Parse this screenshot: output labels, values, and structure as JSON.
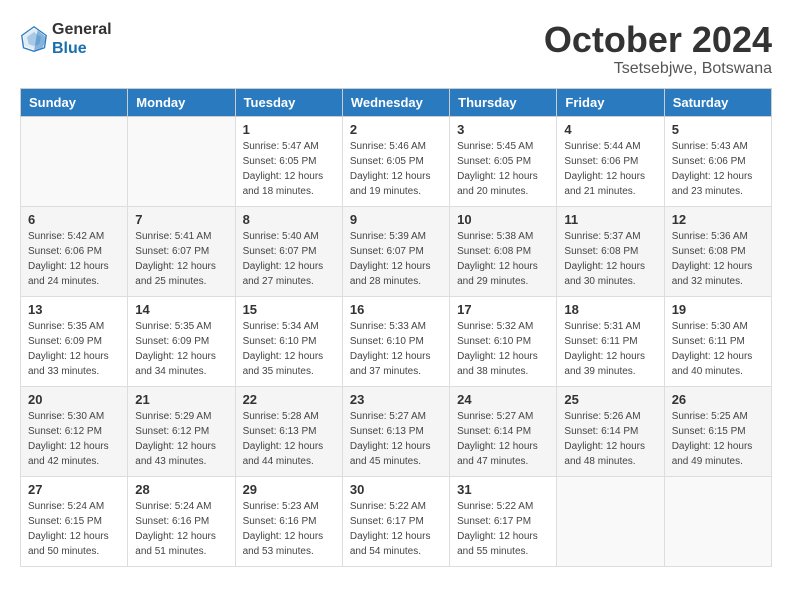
{
  "logo": {
    "general": "General",
    "blue": "Blue"
  },
  "title": "October 2024",
  "location": "Tsetsebjwe, Botswana",
  "days_of_week": [
    "Sunday",
    "Monday",
    "Tuesday",
    "Wednesday",
    "Thursday",
    "Friday",
    "Saturday"
  ],
  "weeks": [
    [
      {
        "day": "",
        "sunrise": "",
        "sunset": "",
        "daylight": ""
      },
      {
        "day": "",
        "sunrise": "",
        "sunset": "",
        "daylight": ""
      },
      {
        "day": "1",
        "sunrise": "Sunrise: 5:47 AM",
        "sunset": "Sunset: 6:05 PM",
        "daylight": "Daylight: 12 hours and 18 minutes."
      },
      {
        "day": "2",
        "sunrise": "Sunrise: 5:46 AM",
        "sunset": "Sunset: 6:05 PM",
        "daylight": "Daylight: 12 hours and 19 minutes."
      },
      {
        "day": "3",
        "sunrise": "Sunrise: 5:45 AM",
        "sunset": "Sunset: 6:05 PM",
        "daylight": "Daylight: 12 hours and 20 minutes."
      },
      {
        "day": "4",
        "sunrise": "Sunrise: 5:44 AM",
        "sunset": "Sunset: 6:06 PM",
        "daylight": "Daylight: 12 hours and 21 minutes."
      },
      {
        "day": "5",
        "sunrise": "Sunrise: 5:43 AM",
        "sunset": "Sunset: 6:06 PM",
        "daylight": "Daylight: 12 hours and 23 minutes."
      }
    ],
    [
      {
        "day": "6",
        "sunrise": "Sunrise: 5:42 AM",
        "sunset": "Sunset: 6:06 PM",
        "daylight": "Daylight: 12 hours and 24 minutes."
      },
      {
        "day": "7",
        "sunrise": "Sunrise: 5:41 AM",
        "sunset": "Sunset: 6:07 PM",
        "daylight": "Daylight: 12 hours and 25 minutes."
      },
      {
        "day": "8",
        "sunrise": "Sunrise: 5:40 AM",
        "sunset": "Sunset: 6:07 PM",
        "daylight": "Daylight: 12 hours and 27 minutes."
      },
      {
        "day": "9",
        "sunrise": "Sunrise: 5:39 AM",
        "sunset": "Sunset: 6:07 PM",
        "daylight": "Daylight: 12 hours and 28 minutes."
      },
      {
        "day": "10",
        "sunrise": "Sunrise: 5:38 AM",
        "sunset": "Sunset: 6:08 PM",
        "daylight": "Daylight: 12 hours and 29 minutes."
      },
      {
        "day": "11",
        "sunrise": "Sunrise: 5:37 AM",
        "sunset": "Sunset: 6:08 PM",
        "daylight": "Daylight: 12 hours and 30 minutes."
      },
      {
        "day": "12",
        "sunrise": "Sunrise: 5:36 AM",
        "sunset": "Sunset: 6:08 PM",
        "daylight": "Daylight: 12 hours and 32 minutes."
      }
    ],
    [
      {
        "day": "13",
        "sunrise": "Sunrise: 5:35 AM",
        "sunset": "Sunset: 6:09 PM",
        "daylight": "Daylight: 12 hours and 33 minutes."
      },
      {
        "day": "14",
        "sunrise": "Sunrise: 5:35 AM",
        "sunset": "Sunset: 6:09 PM",
        "daylight": "Daylight: 12 hours and 34 minutes."
      },
      {
        "day": "15",
        "sunrise": "Sunrise: 5:34 AM",
        "sunset": "Sunset: 6:10 PM",
        "daylight": "Daylight: 12 hours and 35 minutes."
      },
      {
        "day": "16",
        "sunrise": "Sunrise: 5:33 AM",
        "sunset": "Sunset: 6:10 PM",
        "daylight": "Daylight: 12 hours and 37 minutes."
      },
      {
        "day": "17",
        "sunrise": "Sunrise: 5:32 AM",
        "sunset": "Sunset: 6:10 PM",
        "daylight": "Daylight: 12 hours and 38 minutes."
      },
      {
        "day": "18",
        "sunrise": "Sunrise: 5:31 AM",
        "sunset": "Sunset: 6:11 PM",
        "daylight": "Daylight: 12 hours and 39 minutes."
      },
      {
        "day": "19",
        "sunrise": "Sunrise: 5:30 AM",
        "sunset": "Sunset: 6:11 PM",
        "daylight": "Daylight: 12 hours and 40 minutes."
      }
    ],
    [
      {
        "day": "20",
        "sunrise": "Sunrise: 5:30 AM",
        "sunset": "Sunset: 6:12 PM",
        "daylight": "Daylight: 12 hours and 42 minutes."
      },
      {
        "day": "21",
        "sunrise": "Sunrise: 5:29 AM",
        "sunset": "Sunset: 6:12 PM",
        "daylight": "Daylight: 12 hours and 43 minutes."
      },
      {
        "day": "22",
        "sunrise": "Sunrise: 5:28 AM",
        "sunset": "Sunset: 6:13 PM",
        "daylight": "Daylight: 12 hours and 44 minutes."
      },
      {
        "day": "23",
        "sunrise": "Sunrise: 5:27 AM",
        "sunset": "Sunset: 6:13 PM",
        "daylight": "Daylight: 12 hours and 45 minutes."
      },
      {
        "day": "24",
        "sunrise": "Sunrise: 5:27 AM",
        "sunset": "Sunset: 6:14 PM",
        "daylight": "Daylight: 12 hours and 47 minutes."
      },
      {
        "day": "25",
        "sunrise": "Sunrise: 5:26 AM",
        "sunset": "Sunset: 6:14 PM",
        "daylight": "Daylight: 12 hours and 48 minutes."
      },
      {
        "day": "26",
        "sunrise": "Sunrise: 5:25 AM",
        "sunset": "Sunset: 6:15 PM",
        "daylight": "Daylight: 12 hours and 49 minutes."
      }
    ],
    [
      {
        "day": "27",
        "sunrise": "Sunrise: 5:24 AM",
        "sunset": "Sunset: 6:15 PM",
        "daylight": "Daylight: 12 hours and 50 minutes."
      },
      {
        "day": "28",
        "sunrise": "Sunrise: 5:24 AM",
        "sunset": "Sunset: 6:16 PM",
        "daylight": "Daylight: 12 hours and 51 minutes."
      },
      {
        "day": "29",
        "sunrise": "Sunrise: 5:23 AM",
        "sunset": "Sunset: 6:16 PM",
        "daylight": "Daylight: 12 hours and 53 minutes."
      },
      {
        "day": "30",
        "sunrise": "Sunrise: 5:22 AM",
        "sunset": "Sunset: 6:17 PM",
        "daylight": "Daylight: 12 hours and 54 minutes."
      },
      {
        "day": "31",
        "sunrise": "Sunrise: 5:22 AM",
        "sunset": "Sunset: 6:17 PM",
        "daylight": "Daylight: 12 hours and 55 minutes."
      },
      {
        "day": "",
        "sunrise": "",
        "sunset": "",
        "daylight": ""
      },
      {
        "day": "",
        "sunrise": "",
        "sunset": "",
        "daylight": ""
      }
    ]
  ]
}
